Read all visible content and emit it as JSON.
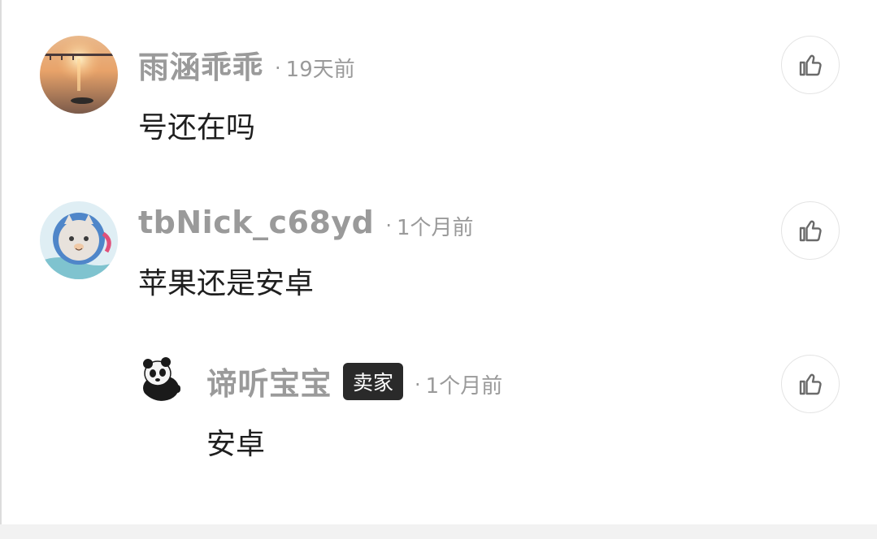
{
  "comments": [
    {
      "username": "雨涵乖乖",
      "separator": "·",
      "time": "19天前",
      "text": "号还在吗",
      "avatar_icon": "sunset-bridge-avatar",
      "like_icon": "thumbs-up-icon"
    },
    {
      "username": "tbNick_c68yd",
      "separator": "·",
      "time": "1个月前",
      "text": "苹果还是安卓",
      "avatar_icon": "cat-astronaut-avatar",
      "like_icon": "thumbs-up-icon"
    }
  ],
  "reply": {
    "username": "谛听宝宝",
    "badge": "卖家",
    "separator": "·",
    "time": "1个月前",
    "text": "安卓",
    "avatar_icon": "panda-avatar",
    "like_icon": "thumbs-up-icon"
  },
  "colors": {
    "username": "#9a9a9a",
    "text": "#1f1f1f",
    "badge_bg": "#2a2a2a",
    "badge_text": "#ffffff"
  }
}
